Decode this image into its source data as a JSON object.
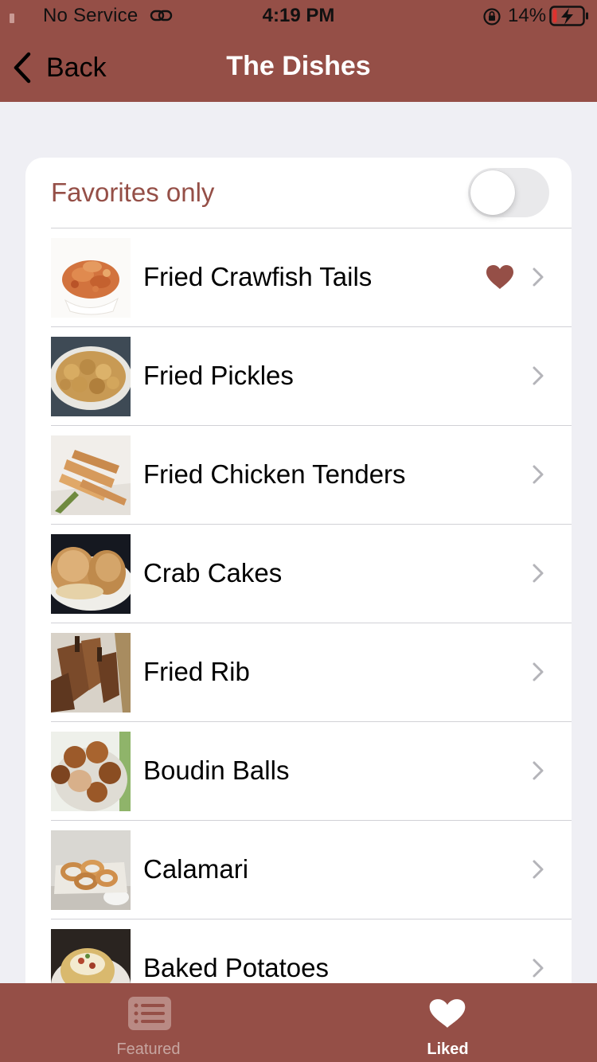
{
  "colors": {
    "brand": "#954f47",
    "background": "#efeff4",
    "card": "#ffffff",
    "separator": "#d1d1d6",
    "heart": "#954f47",
    "chevron": "#b4b4b9",
    "tab_inactive": "#c7a6a1",
    "tab_active": "#ffffff"
  },
  "status_bar": {
    "carrier": "No Service",
    "time": "4:19 PM",
    "battery_percent": "14%",
    "battery_level": 0.14,
    "icons": [
      "link-icon",
      "orientation-lock-icon",
      "battery-charging-icon"
    ]
  },
  "nav": {
    "back_label": "Back",
    "title": "The Dishes",
    "back_icon": "chevron-left-icon"
  },
  "filter": {
    "label": "Favorites only",
    "toggle_on": false
  },
  "dishes": [
    {
      "name": "Fried Crawfish Tails",
      "favorite": true
    },
    {
      "name": "Fried Pickles",
      "favorite": false
    },
    {
      "name": "Fried Chicken Tenders",
      "favorite": false
    },
    {
      "name": "Crab Cakes",
      "favorite": false
    },
    {
      "name": "Fried Rib",
      "favorite": false
    },
    {
      "name": "Boudin Balls",
      "favorite": false
    },
    {
      "name": "Calamari",
      "favorite": false
    },
    {
      "name": "Baked Potatoes",
      "favorite": false
    }
  ],
  "tab_bar": {
    "tabs": [
      {
        "label": "Featured",
        "icon": "list-icon",
        "selected": false
      },
      {
        "label": "Liked",
        "icon": "heart-icon",
        "selected": true
      }
    ]
  }
}
